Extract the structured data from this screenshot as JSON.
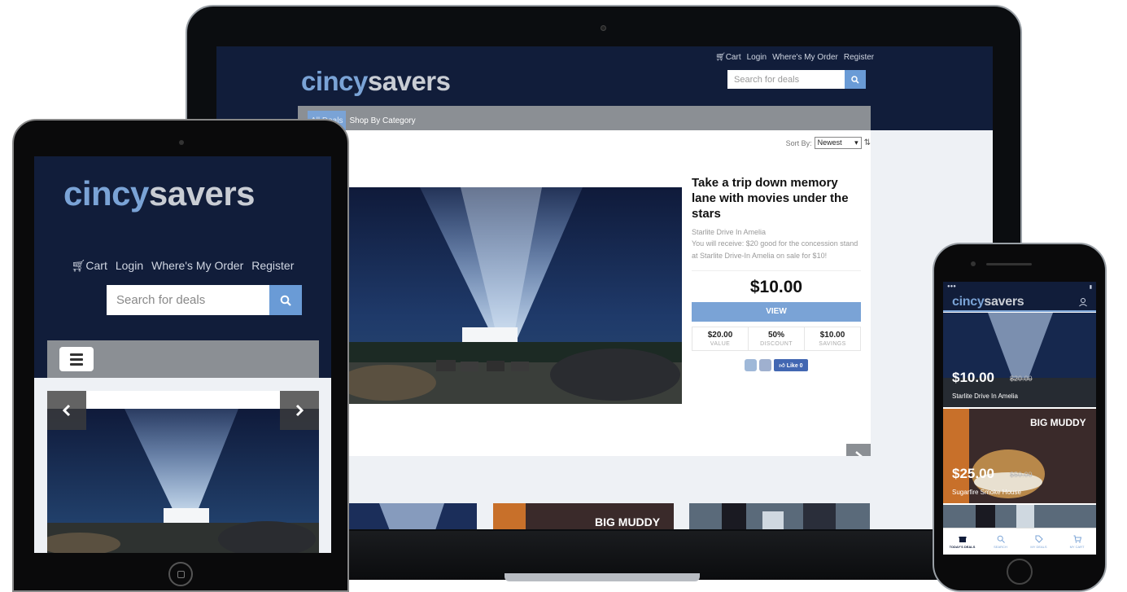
{
  "brand": {
    "logo_part1": "cincy",
    "logo_part2": "savers"
  },
  "laptop": {
    "top_nav": [
      "Cart",
      "Login",
      "Where's My Order",
      "Register"
    ],
    "search_placeholder": "Search for deals",
    "tabs": [
      "All Deals",
      "Shop By Category"
    ],
    "sort_label": "Sort By:",
    "sort_value": "Newest",
    "deal": {
      "title": "Take a trip down memory lane with movies under the stars",
      "merchant": "Starlite Drive In Amelia",
      "description": "You will receive: $20 good for the concession stand at Starlite Drive-In Amelia on sale for $10!",
      "price": "$10.00",
      "view_label": "VIEW",
      "stats": [
        {
          "value": "$20.00",
          "label": "VALUE"
        },
        {
          "value": "50%",
          "label": "DISCOUNT"
        },
        {
          "value": "$10.00",
          "label": "SAVINGS"
        }
      ],
      "like_label": "Like 0"
    },
    "thumb_text": "BIG MUDDY"
  },
  "tablet": {
    "nav": [
      "Cart",
      "Login",
      "Where's My Order",
      "Register"
    ],
    "search_placeholder": "Search for deals"
  },
  "phone": {
    "cards": [
      {
        "price": "$10.00",
        "old_price": "$20.00",
        "name": "Starlite Drive In Amelia"
      },
      {
        "price": "$25.00",
        "old_price": "$50.00",
        "name": "Sugarfire Smoke House",
        "overlay": "BIG MUDDY"
      }
    ],
    "tabs": [
      "TODAY'S DEALS",
      "SEARCH",
      "MY DEALS",
      "MY CART"
    ]
  },
  "colors": {
    "navy": "#111d3a",
    "accent": "#7aa3d6",
    "gray_bar": "#8b8f94"
  }
}
